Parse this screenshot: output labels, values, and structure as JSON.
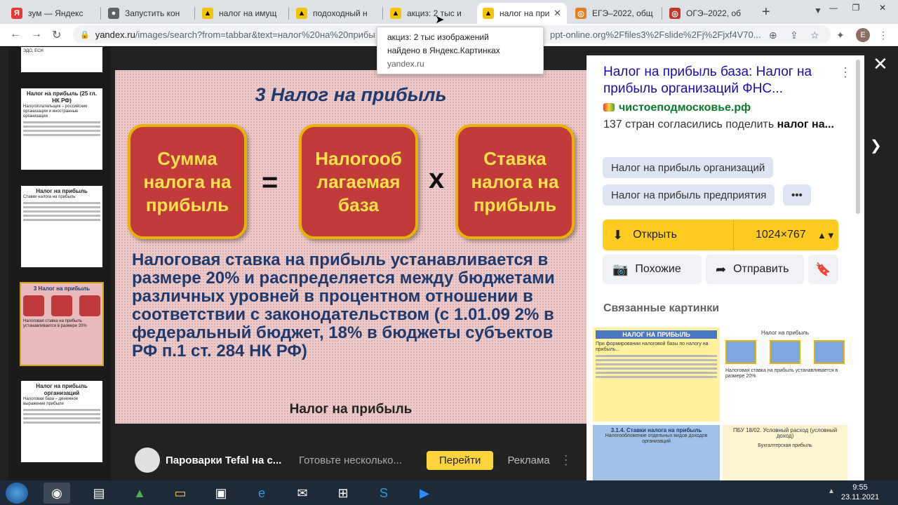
{
  "browser": {
    "tabs": [
      {
        "label": "зум — Яндекс",
        "fav": "Я",
        "fav_color": "#e53935"
      },
      {
        "label": "Запустить кон",
        "fav": "●",
        "fav_color": "#555555"
      },
      {
        "label": "налог на имущ",
        "fav": "▲",
        "fav_color": "#333333"
      },
      {
        "label": "подоходный н",
        "fav": "▲",
        "fav_color": "#333333"
      },
      {
        "label": "акциз: 2 тыс и",
        "fav": "▲",
        "fav_color": "#333333"
      },
      {
        "label": "налог на приб",
        "fav": "▲",
        "fav_color": "#333333"
      },
      {
        "label": "ЕГЭ–2022, общ",
        "fav": "◎",
        "fav_color": "#e67e22"
      },
      {
        "label": "ОГЭ–2022, об",
        "fav": "◎",
        "fav_color": "#c0392b"
      }
    ],
    "url_host": "yandex.ru",
    "url_path": "/images/search?from=tabbar&text=налог%20на%20прибы",
    "url_tail": "ppt-online.org%2Ffiles3%2Fslide%2Fj%2Fjxf4V70...",
    "profile_initial": "E"
  },
  "tooltip": {
    "line1": "акциз: 2 тыс изображений",
    "line2": "найдено в Яндекс.Картинках",
    "source": "yandex.ru"
  },
  "thumbnails": [
    {
      "title": "",
      "text": "ЭДО, ЕСН"
    },
    {
      "title": "Налог на прибыль (25 гл. НК РФ)",
      "text": "Налогоплательщик – российские организации и иностранные организации"
    },
    {
      "title": "Налог на прибыль",
      "text": "Ставки налога на прибыль"
    },
    {
      "title": "3 Налог на прибыль",
      "text": "Налоговая ставка на прибыль устанавливается в размере 20%"
    },
    {
      "title": "Налог на прибыль организаций",
      "text": "Налоговая база – денежное выражение прибыли"
    }
  ],
  "slide": {
    "title": "3 Налог на прибыль",
    "box1": "Сумма налога на прибыль",
    "op1": "=",
    "box2": "Налогооб лагаемая база",
    "op2": "x",
    "box3": "Ставка налога на прибыль",
    "body": "Налоговая ставка на прибыль устанавливается в размере 20% и распределяется между бюджетами различных уровней в процентном отношении в соответствии с законодательством (с 1.01.09 2% в федеральный бюджет, 18% в бюджеты субъектов РФ п.1 ст. 284 НК РФ)",
    "caption": "Налог на прибыль"
  },
  "ad": {
    "title": "Пароварки Tefal на с...",
    "desc": "Готовьте несколько...",
    "button": "Перейти",
    "label": "Реклама"
  },
  "panel": {
    "title": "Налог на прибыль база: Налог на прибыль организаций ФНС...",
    "site": "чистоеподмосковье.рф",
    "desc_prefix": "137 стран согласились поделить ",
    "desc_bold": "налог на...",
    "chips": [
      "Налог на прибыль организаций",
      "Налог на прибыль предприятия"
    ],
    "more_chip": "•••",
    "open_label": "Открыть",
    "size": "1024×767",
    "similar_label": "Похожие",
    "share_label": "Отправить",
    "related_title": "Связанные картинки",
    "related": [
      {
        "title": "НАЛОГ НА ПРИБЫЛЬ",
        "text": "При формировании налоговой базы по налогу на прибыль..."
      },
      {
        "title": "Налог на прибыль",
        "text": "Налоговая ставка на прибыль устанавливается в размере 20%"
      },
      {
        "title": "3.1.4. Ставки налога на прибыль",
        "text": "Налогообложение отдельных видов доходов организаций"
      },
      {
        "title": "ПБУ 18/02. Условный расход (условный доход)",
        "text": "Бухгалтерская прибыль"
      }
    ]
  },
  "taskbar": {
    "time": "9:55",
    "date": "23.11.2021"
  },
  "colors": {
    "slide_bg": "#eec9c9",
    "box_red": "#c23b3b",
    "box_text": "#ffe14d",
    "title_blue": "#1f3a6e",
    "open_yellow": "#ffcc1f"
  }
}
